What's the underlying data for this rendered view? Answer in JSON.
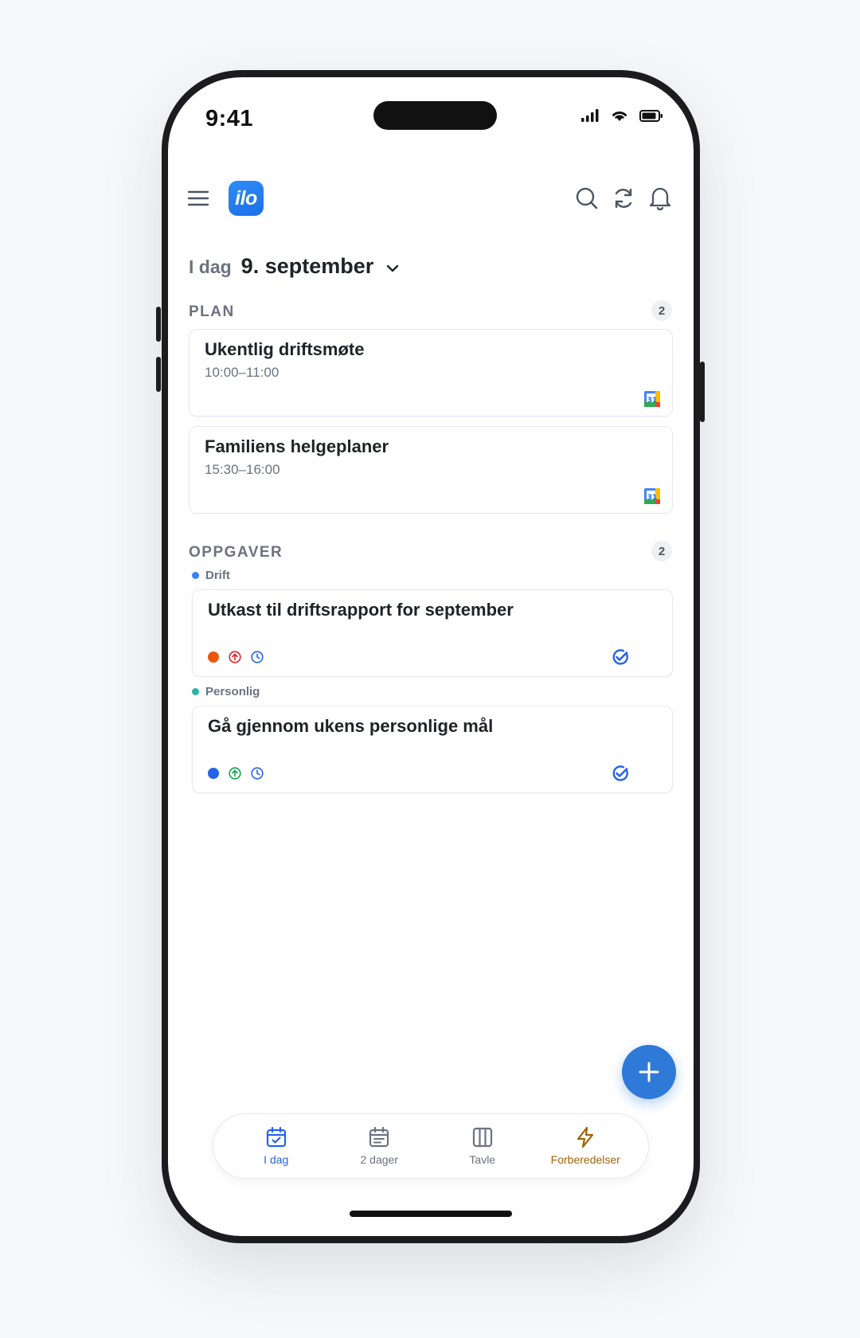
{
  "status": {
    "time": "9:41"
  },
  "header": {
    "logo_text": "ilo"
  },
  "date": {
    "prefix": "I dag",
    "main": "9. september"
  },
  "plan": {
    "title": "PLAN",
    "count": "2",
    "events": [
      {
        "title": "Ukentlig driftsmøte",
        "time": "10:00–11:00"
      },
      {
        "title": "Familiens helgeplaner",
        "time": "15:30–16:00"
      }
    ]
  },
  "tasks": {
    "title": "OPPGAVER",
    "count": "2",
    "groups": [
      {
        "label": "Drift",
        "color": "#3b82f6",
        "task": "Utkast til driftsrapport for september",
        "status_color": "#ea580c",
        "priority_color": "#dc2626"
      },
      {
        "label": "Personlig",
        "color": "#2bb3a3",
        "task": "Gå gjennom ukens personlige mål",
        "status_color": "#2563eb",
        "priority_color": "#16a34a"
      }
    ]
  },
  "tabs": [
    {
      "label": "I dag",
      "icon": "calendar-check-icon",
      "color": "#2563eb"
    },
    {
      "label": "2 dager",
      "icon": "calendar-list-icon",
      "color": "#6b7280"
    },
    {
      "label": "Tavle",
      "icon": "columns-icon",
      "color": "#6b7280"
    },
    {
      "label": "Forberedelser",
      "icon": "lightning-icon",
      "color": "#a16207"
    }
  ]
}
